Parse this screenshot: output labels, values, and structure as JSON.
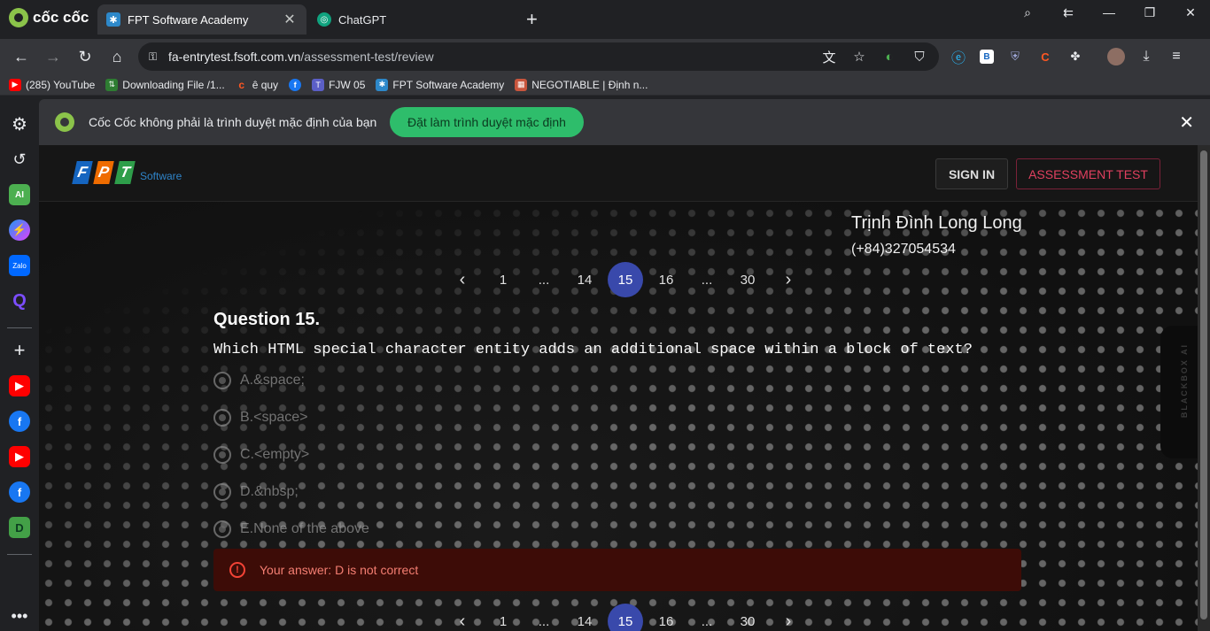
{
  "browser": {
    "brand": "cốc cốc",
    "tabs": [
      {
        "title": "FPT Software Academy",
        "active": true,
        "icon": "fpt-academy-icon"
      },
      {
        "title": "ChatGPT",
        "active": false,
        "icon": "chatgpt-icon"
      }
    ],
    "url_host": "fa-entrytest.fsoft.com.vn",
    "url_path": "/assessment-test/review",
    "bookmarks": [
      {
        "label": "(285) YouTube",
        "icon": "youtube-icon",
        "color": "#ff0000"
      },
      {
        "label": "Downloading File /1...",
        "icon": "download-icon",
        "color": "#4caf50"
      },
      {
        "label": "ê quy",
        "icon": "coccoc-icon",
        "color": "#ff5722"
      },
      {
        "label": "",
        "icon": "facebook-icon",
        "color": "#1877f2"
      },
      {
        "label": "FJW 05",
        "icon": "teams-icon",
        "color": "#5b5fc7"
      },
      {
        "label": "FPT Software Academy",
        "icon": "fpt-academy-icon",
        "color": "#2d88c9"
      },
      {
        "label": "NEGOTIABLE | Định n...",
        "icon": "doc-icon",
        "color": "#c8553d"
      }
    ]
  },
  "infobar": {
    "message": "Cốc Cốc không phải là trình duyệt mặc định của bạn",
    "button": "Đặt làm trình duyệt mặc định"
  },
  "site": {
    "logo_text": "Software",
    "signin": "SIGN IN",
    "assessment": "ASSESSMENT TEST"
  },
  "user": {
    "name": "Trịnh Đình Long Long",
    "phone": "(+84)327054534"
  },
  "pagination": {
    "pages": [
      "1",
      "...",
      "14",
      "15",
      "16",
      "...",
      "30"
    ],
    "current": "15"
  },
  "question": {
    "title": "Question 15.",
    "text": "Which HTML special character entity adds an additional space within a block of text?",
    "options": [
      "A.&space;",
      "B.<space>",
      "C.<empty>",
      "D.&nbsp;",
      "E.None of the above"
    ]
  },
  "result": {
    "message": "Your answer: D is not correct",
    "color": "#f44336"
  },
  "side_widget": "BLACKBOX AI"
}
